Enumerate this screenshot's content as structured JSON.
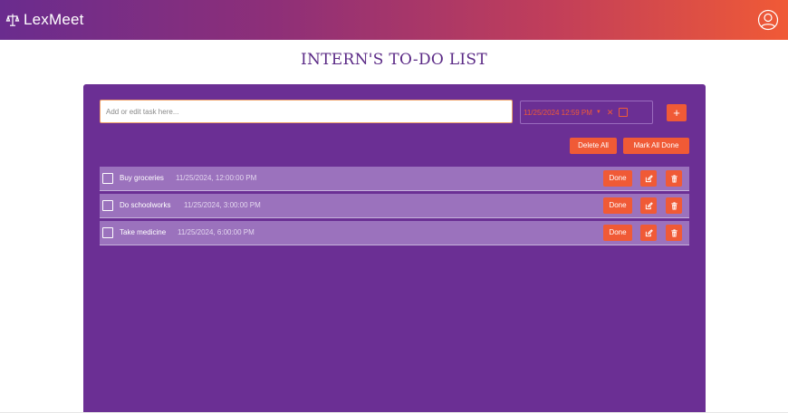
{
  "header": {
    "brand_name": "LexMeet",
    "brand_icon": "scales-icon",
    "user_icon": "user-profile-icon",
    "gradient_start": "#6a2c8e",
    "gradient_end": "#f05a36"
  },
  "page": {
    "title": "INTERN'S TO-DO LIST"
  },
  "form": {
    "task_placeholder": "Add or edit task here...",
    "task_value": "",
    "datetime_value": "11/25/2024 12:59  PM",
    "datetime_dropdown_icon": "chevron-down-icon",
    "datetime_clear_icon": "close-icon",
    "datetime_calendar_icon": "calendar-icon",
    "add_label": "+"
  },
  "actions": {
    "delete_all_label": "Delete All",
    "mark_all_done_label": "Mark All Done"
  },
  "tasks": [
    {
      "name": "Buy groceries",
      "datetime": "11/25/2024, 12:00:00 PM",
      "done_label": "Done",
      "checked": false
    },
    {
      "name": "Do schoolworks",
      "datetime": "11/25/2024, 3:00:00 PM",
      "done_label": "Done",
      "checked": false
    },
    {
      "name": "Take medicine",
      "datetime": "11/25/2024, 6:00:00 PM",
      "done_label": "Done",
      "checked": false
    }
  ],
  "colors": {
    "accent": "#f05a36",
    "panel": "#6b2f94",
    "row": "#9b72bd",
    "title": "#5b2a86"
  }
}
